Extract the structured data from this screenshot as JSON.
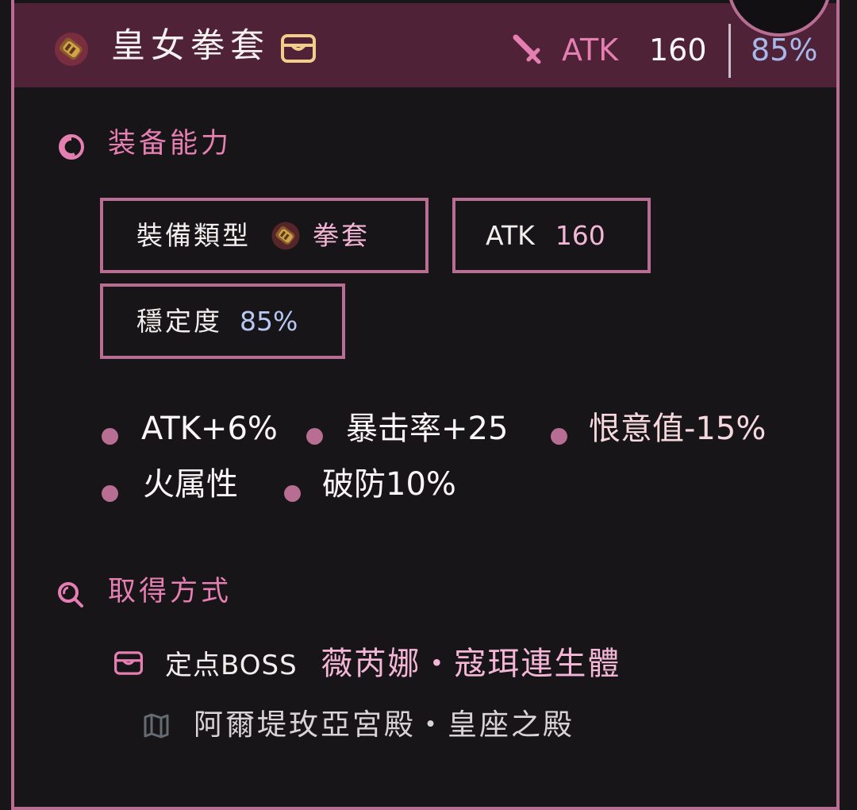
{
  "header": {
    "item_name": "皇女拳套",
    "item_icon": "gauntlet-icon",
    "storage_icon": "chest-icon",
    "atk_label": "ATK",
    "atk_value": "160",
    "stability_value": "85%"
  },
  "abilities": {
    "section_title": "装备能力",
    "section_icon": "swirl-icon",
    "type_label": "裝備類型",
    "type_value": "拳套",
    "atk_label": "ATK",
    "atk_value": "160",
    "stability_label": "穩定度",
    "stability_value": "85%",
    "effects": [
      "ATK+6%",
      "暴击率+25",
      "恨意值-15%",
      "火属性",
      "破防10%"
    ]
  },
  "acquire": {
    "section_title": "取得方式",
    "section_icon": "search-icon",
    "source_prefix": "定点BOSS",
    "source_name": "薇芮娜・寇珥連生體",
    "location": "阿爾堤玫亞宮殿・皇座之殿"
  },
  "colors": {
    "accent": "#b86d93",
    "header_bg": "#4f2238",
    "page_bg": "#171517",
    "pink_text": "#e57fb2",
    "blue_text": "#a7b9ea"
  }
}
